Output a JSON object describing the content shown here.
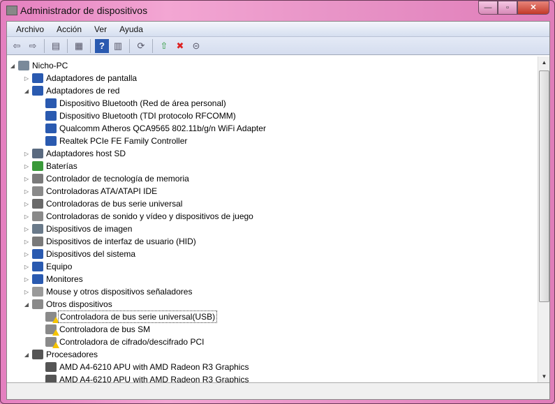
{
  "window": {
    "title": "Administrador de dispositivos",
    "min": "—",
    "max": "▫",
    "close": "✕"
  },
  "menu": [
    "Archivo",
    "Acción",
    "Ver",
    "Ayuda"
  ],
  "toolbar": [
    {
      "name": "back-icon",
      "g": "⇦"
    },
    {
      "name": "forward-icon",
      "g": "⇨"
    },
    {
      "sep": true
    },
    {
      "name": "show-hide-tree-icon",
      "g": "▤"
    },
    {
      "sep": true
    },
    {
      "name": "properties-icon",
      "g": "▦"
    },
    {
      "sep": true
    },
    {
      "name": "help-icon",
      "g": "?"
    },
    {
      "name": "action-pane-icon",
      "g": "▥"
    },
    {
      "sep": true
    },
    {
      "name": "scan-hardware-icon",
      "g": "⟳"
    },
    {
      "sep": true
    },
    {
      "name": "update-driver-icon",
      "g": "⇧"
    },
    {
      "name": "uninstall-icon",
      "g": "✖"
    },
    {
      "name": "disable-icon",
      "g": "⊝"
    }
  ],
  "tree": [
    {
      "level": 0,
      "label": "Nicho-PC",
      "exp": "open",
      "color": "#7a8a9a"
    },
    {
      "level": 1,
      "label": "Adaptadores de pantalla",
      "exp": "closed",
      "color": "#2a5ab0"
    },
    {
      "level": 1,
      "label": "Adaptadores de red",
      "exp": "open",
      "color": "#2a5ab0"
    },
    {
      "level": 2,
      "label": "Dispositivo Bluetooth (Red de área personal)",
      "color": "#2a5ab0"
    },
    {
      "level": 2,
      "label": "Dispositivo Bluetooth (TDI protocolo RFCOMM)",
      "color": "#2a5ab0"
    },
    {
      "level": 2,
      "label": "Qualcomm Atheros QCA9565 802.11b/g/n WiFi Adapter",
      "color": "#2a5ab0"
    },
    {
      "level": 2,
      "label": "Realtek PCIe FE Family Controller",
      "color": "#2a5ab0"
    },
    {
      "level": 1,
      "label": "Adaptadores host SD",
      "exp": "closed",
      "color": "#5a6a80"
    },
    {
      "level": 1,
      "label": "Baterías",
      "exp": "closed",
      "color": "#3a9a3a"
    },
    {
      "level": 1,
      "label": "Controlador de tecnología de memoria",
      "exp": "closed",
      "color": "#7a7a7a"
    },
    {
      "level": 1,
      "label": "Controladoras ATA/ATAPI IDE",
      "exp": "closed",
      "color": "#8a8a8a"
    },
    {
      "level": 1,
      "label": "Controladoras de bus serie universal",
      "exp": "closed",
      "color": "#6a6a6a"
    },
    {
      "level": 1,
      "label": "Controladoras de sonido y vídeo y dispositivos de juego",
      "exp": "closed",
      "color": "#8a8a8a"
    },
    {
      "level": 1,
      "label": "Dispositivos de imagen",
      "exp": "closed",
      "color": "#6a7a8a"
    },
    {
      "level": 1,
      "label": "Dispositivos de interfaz de usuario (HID)",
      "exp": "closed",
      "color": "#7a7a7a"
    },
    {
      "level": 1,
      "label": "Dispositivos del sistema",
      "exp": "closed",
      "color": "#2a5ab0"
    },
    {
      "level": 1,
      "label": "Equipo",
      "exp": "closed",
      "color": "#2a5ab0"
    },
    {
      "level": 1,
      "label": "Monitores",
      "exp": "closed",
      "color": "#2a5ab0"
    },
    {
      "level": 1,
      "label": "Mouse y otros dispositivos señaladores",
      "exp": "closed",
      "color": "#9a9a9a"
    },
    {
      "level": 1,
      "label": "Otros dispositivos",
      "exp": "open",
      "color": "#8a8a8a"
    },
    {
      "level": 2,
      "label": "Controladora de bus serie universal(USB)",
      "color": "#8a8a8a",
      "warn": true,
      "selected": true
    },
    {
      "level": 2,
      "label": "Controladora de bus SM",
      "color": "#8a8a8a",
      "warn": true
    },
    {
      "level": 2,
      "label": "Controladora de cifrado/descifrado PCI",
      "color": "#8a8a8a",
      "warn": true
    },
    {
      "level": 1,
      "label": "Procesadores",
      "exp": "open",
      "color": "#555555"
    },
    {
      "level": 2,
      "label": "AMD A4-6210 APU with AMD Radeon R3 Graphics",
      "color": "#555555"
    },
    {
      "level": 2,
      "label": "AMD A4-6210 APU with AMD Radeon R3 Graphics",
      "color": "#555555"
    }
  ]
}
